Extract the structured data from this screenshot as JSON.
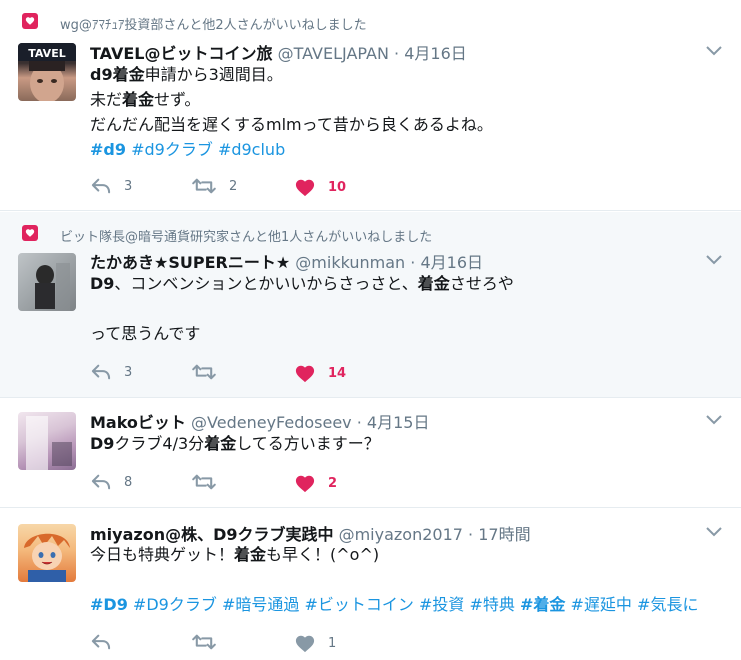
{
  "tweets": [
    {
      "social": "wg@ｱﾏﾁｭｱ投資部さんと他2人さんがいいねしました",
      "name": "TAVEL@ビットコイン旅",
      "handle": "@TAVELJAPAN",
      "dot": "·",
      "time": "4月16日",
      "avatar_text": "TAVEL",
      "lines": [
        [
          {
            "t": "d9着金",
            "s": "b"
          },
          {
            "t": "申請から3週間目。"
          }
        ],
        [
          {
            "t": "未だ"
          },
          {
            "t": "着金",
            "s": "b"
          },
          {
            "t": "せず。"
          }
        ],
        [
          {
            "t": "だんだん配当を遅くするmlmって昔から良くあるよね。"
          }
        ],
        [
          {
            "t": "#d9",
            "s": "tagb"
          },
          {
            "t": " "
          },
          {
            "t": "#d9クラブ",
            "s": "tag"
          },
          {
            "t": " "
          },
          {
            "t": "#d9club",
            "s": "tag"
          }
        ]
      ],
      "reply_count": "3",
      "retweet_count": "2",
      "like_count": "10",
      "liked": true
    },
    {
      "social": "ビット隊長@暗号通貨研究家さんと他1人さんがいいねしました",
      "name": "たかあき★SUPERニート★",
      "handle": "@mikkunman",
      "dot": "·",
      "time": "4月16日",
      "lines": [
        [
          {
            "t": "D9",
            "s": "b"
          },
          {
            "t": "、コンベンションとかいいからさっさと、"
          },
          {
            "t": "着金",
            "s": "b"
          },
          {
            "t": "させろや"
          }
        ],
        [],
        [
          {
            "t": "って思うんです"
          }
        ]
      ],
      "reply_count": "3",
      "retweet_count": "",
      "like_count": "14",
      "liked": true
    },
    {
      "name": "Makoビット",
      "handle": "@VedeneyFedoseev",
      "dot": "·",
      "time": "4月15日",
      "lines": [
        [
          {
            "t": "D9",
            "s": "b"
          },
          {
            "t": "クラブ4/3分"
          },
          {
            "t": "着金",
            "s": "b"
          },
          {
            "t": "してる方いますー？"
          }
        ]
      ],
      "reply_count": "8",
      "retweet_count": "",
      "like_count": "2",
      "liked": true
    },
    {
      "name": "miyazon@株、D9クラブ実践中",
      "handle": "@miyazon2017",
      "dot": "·",
      "time": "17時間",
      "lines": [
        [
          {
            "t": "今日も特典ゲット！"
          },
          {
            "t": "着金",
            "s": "b"
          },
          {
            "t": "も早く！(^o^)"
          }
        ],
        [],
        [
          {
            "t": "#D9",
            "s": "tagb"
          },
          {
            "t": " "
          },
          {
            "t": "#D9クラブ",
            "s": "tag"
          },
          {
            "t": " "
          },
          {
            "t": "#暗号通過",
            "s": "tag"
          },
          {
            "t": " "
          },
          {
            "t": "#ビットコイン",
            "s": "tag"
          },
          {
            "t": " "
          },
          {
            "t": "#投資",
            "s": "tag"
          },
          {
            "t": " "
          },
          {
            "t": "#特典",
            "s": "tag"
          },
          {
            "t": " "
          },
          {
            "t": "#着金",
            "s": "tagb"
          },
          {
            "t": " "
          },
          {
            "t": "#遅延中",
            "s": "tag"
          },
          {
            "t": " "
          },
          {
            "t": "#気長に",
            "s": "tag"
          }
        ]
      ],
      "reply_count": "",
      "retweet_count": "",
      "like_count": "1",
      "liked": false
    }
  ],
  "colors": {
    "like": "#e0245e",
    "link": "#1b95e0",
    "muted": "#657786",
    "icon": "#8899a6"
  }
}
